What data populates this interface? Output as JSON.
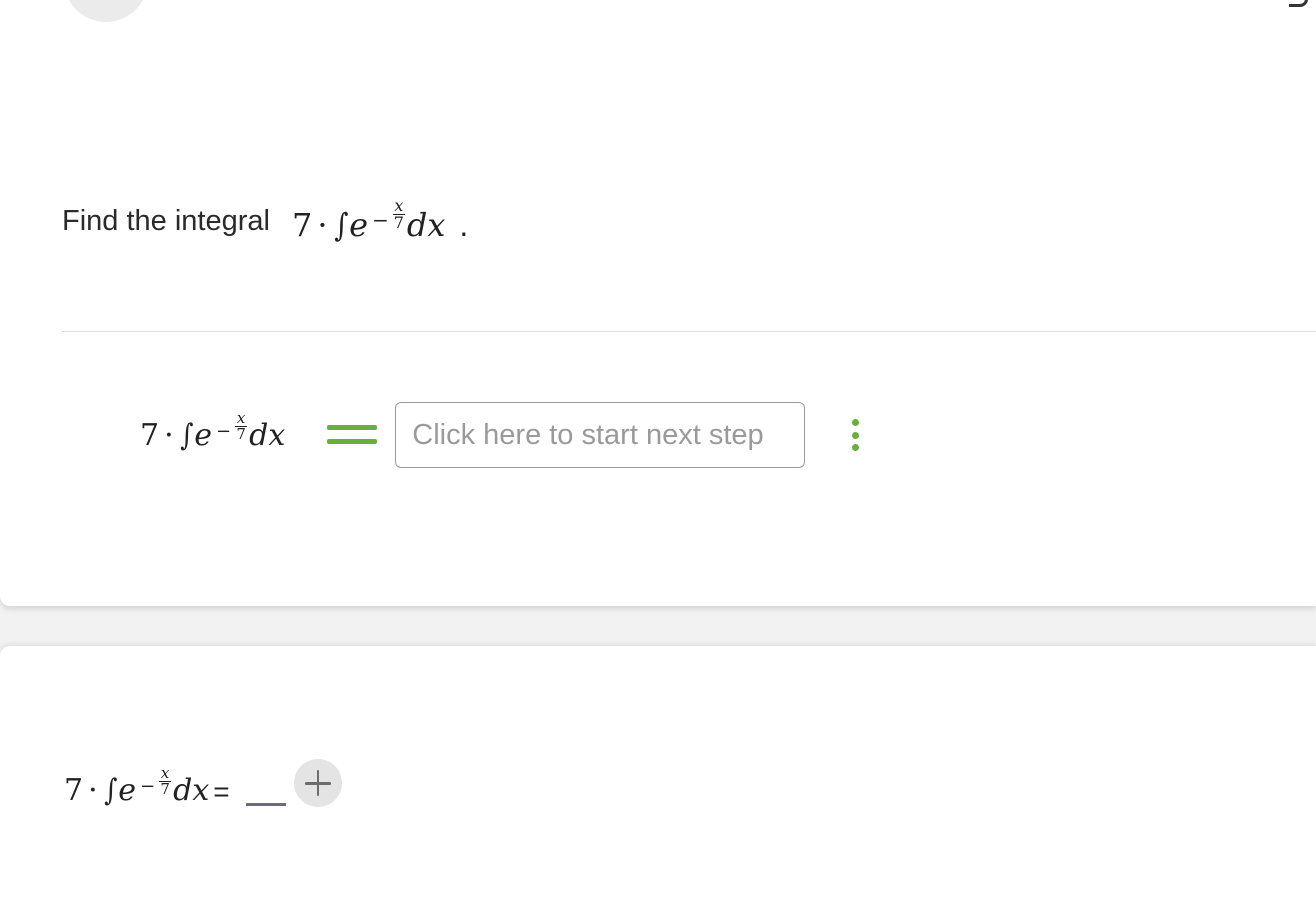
{
  "prompt": {
    "text": "Find the integral",
    "expression": {
      "coefficient": "7",
      "dot": "·",
      "integral": "∫",
      "base": "e",
      "exponent_sign": "−",
      "exponent_numerator": "x",
      "exponent_denominator": "7",
      "differential": "dx",
      "trailing": "."
    }
  },
  "step": {
    "expression": {
      "coefficient": "7",
      "dot": "·",
      "integral": "∫",
      "base": "e",
      "exponent_sign": "−",
      "exponent_numerator": "x",
      "exponent_denominator": "7",
      "differential": "dx"
    },
    "input_placeholder": "Click here to start next step",
    "equals_icon": "equals-icon",
    "menu_icon": "kebab-vertical-icon"
  },
  "answer": {
    "expression": {
      "coefficient": "7",
      "dot": "·",
      "integral": "∫",
      "base": "e",
      "exponent_sign": "−",
      "exponent_numerator": "x",
      "exponent_denominator": "7",
      "differential": "dx",
      "equals": "="
    },
    "add_icon": "plus-icon"
  },
  "colors": {
    "accent_green": "#6aaf3d",
    "divider": "#dcdcdc",
    "placeholder": "#9a9a9a"
  }
}
